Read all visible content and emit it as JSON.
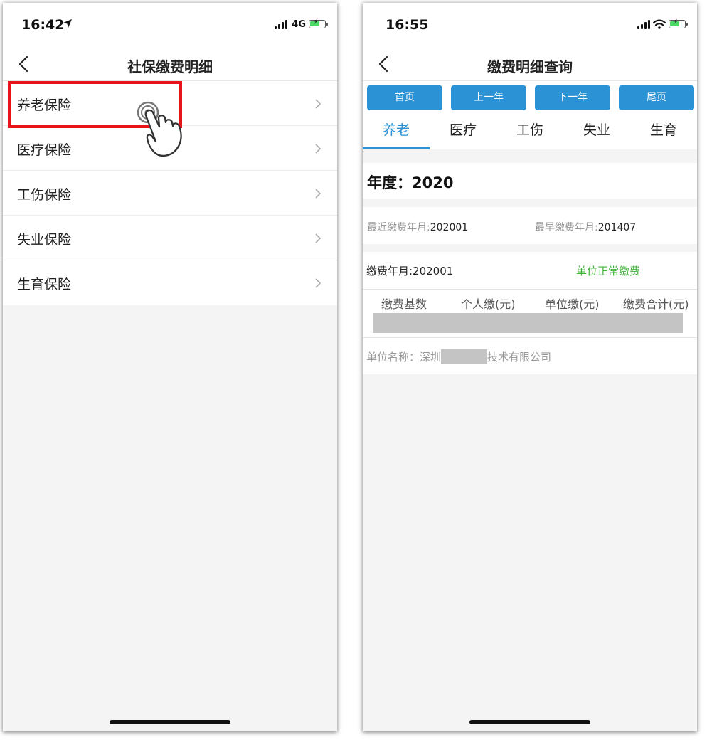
{
  "left_screen": {
    "status": {
      "time": "16:42",
      "network": "4G"
    },
    "nav": {
      "title": "社保缴费明细"
    },
    "menu_items": [
      {
        "label": "养老保险"
      },
      {
        "label": "医疗保险"
      },
      {
        "label": "工伤保险"
      },
      {
        "label": "失业保险"
      },
      {
        "label": "生育保险"
      }
    ],
    "highlighted_item": "养老保险"
  },
  "right_screen": {
    "status": {
      "time": "16:55"
    },
    "nav": {
      "title": "缴费明细查询"
    },
    "page_buttons": [
      "首页",
      "上一年",
      "下一年",
      "尾页"
    ],
    "tabs": [
      {
        "label": "养老",
        "active": true
      },
      {
        "label": "医疗",
        "active": false
      },
      {
        "label": "工伤",
        "active": false
      },
      {
        "label": "失业",
        "active": false
      },
      {
        "label": "生育",
        "active": false
      }
    ],
    "year": "年度：2020",
    "recent_label": "最近缴费年月:",
    "recent_value": "202001",
    "earliest_label": "最早缴费年月:",
    "earliest_value": "201407",
    "pay_month": "缴费年月:202001",
    "pay_status": "单位正常缴费",
    "table_headers": [
      "缴费基数",
      "个人缴(元)",
      "单位缴(元)",
      "缴费合计(元)"
    ],
    "company_prefix": "单位名称：深圳",
    "company_suffix": "技术有限公司"
  },
  "colors": {
    "accent_blue": "#2b93d5",
    "status_green": "#3cb034",
    "highlight_red": "#e8141b",
    "background_gray": "#f4f4f4"
  },
  "icons": [
    "back-chevron-icon",
    "chevron-right-icon",
    "location-arrow-icon",
    "signal-icon",
    "wifi-icon",
    "battery-charging-icon",
    "tap-hand-icon"
  ]
}
